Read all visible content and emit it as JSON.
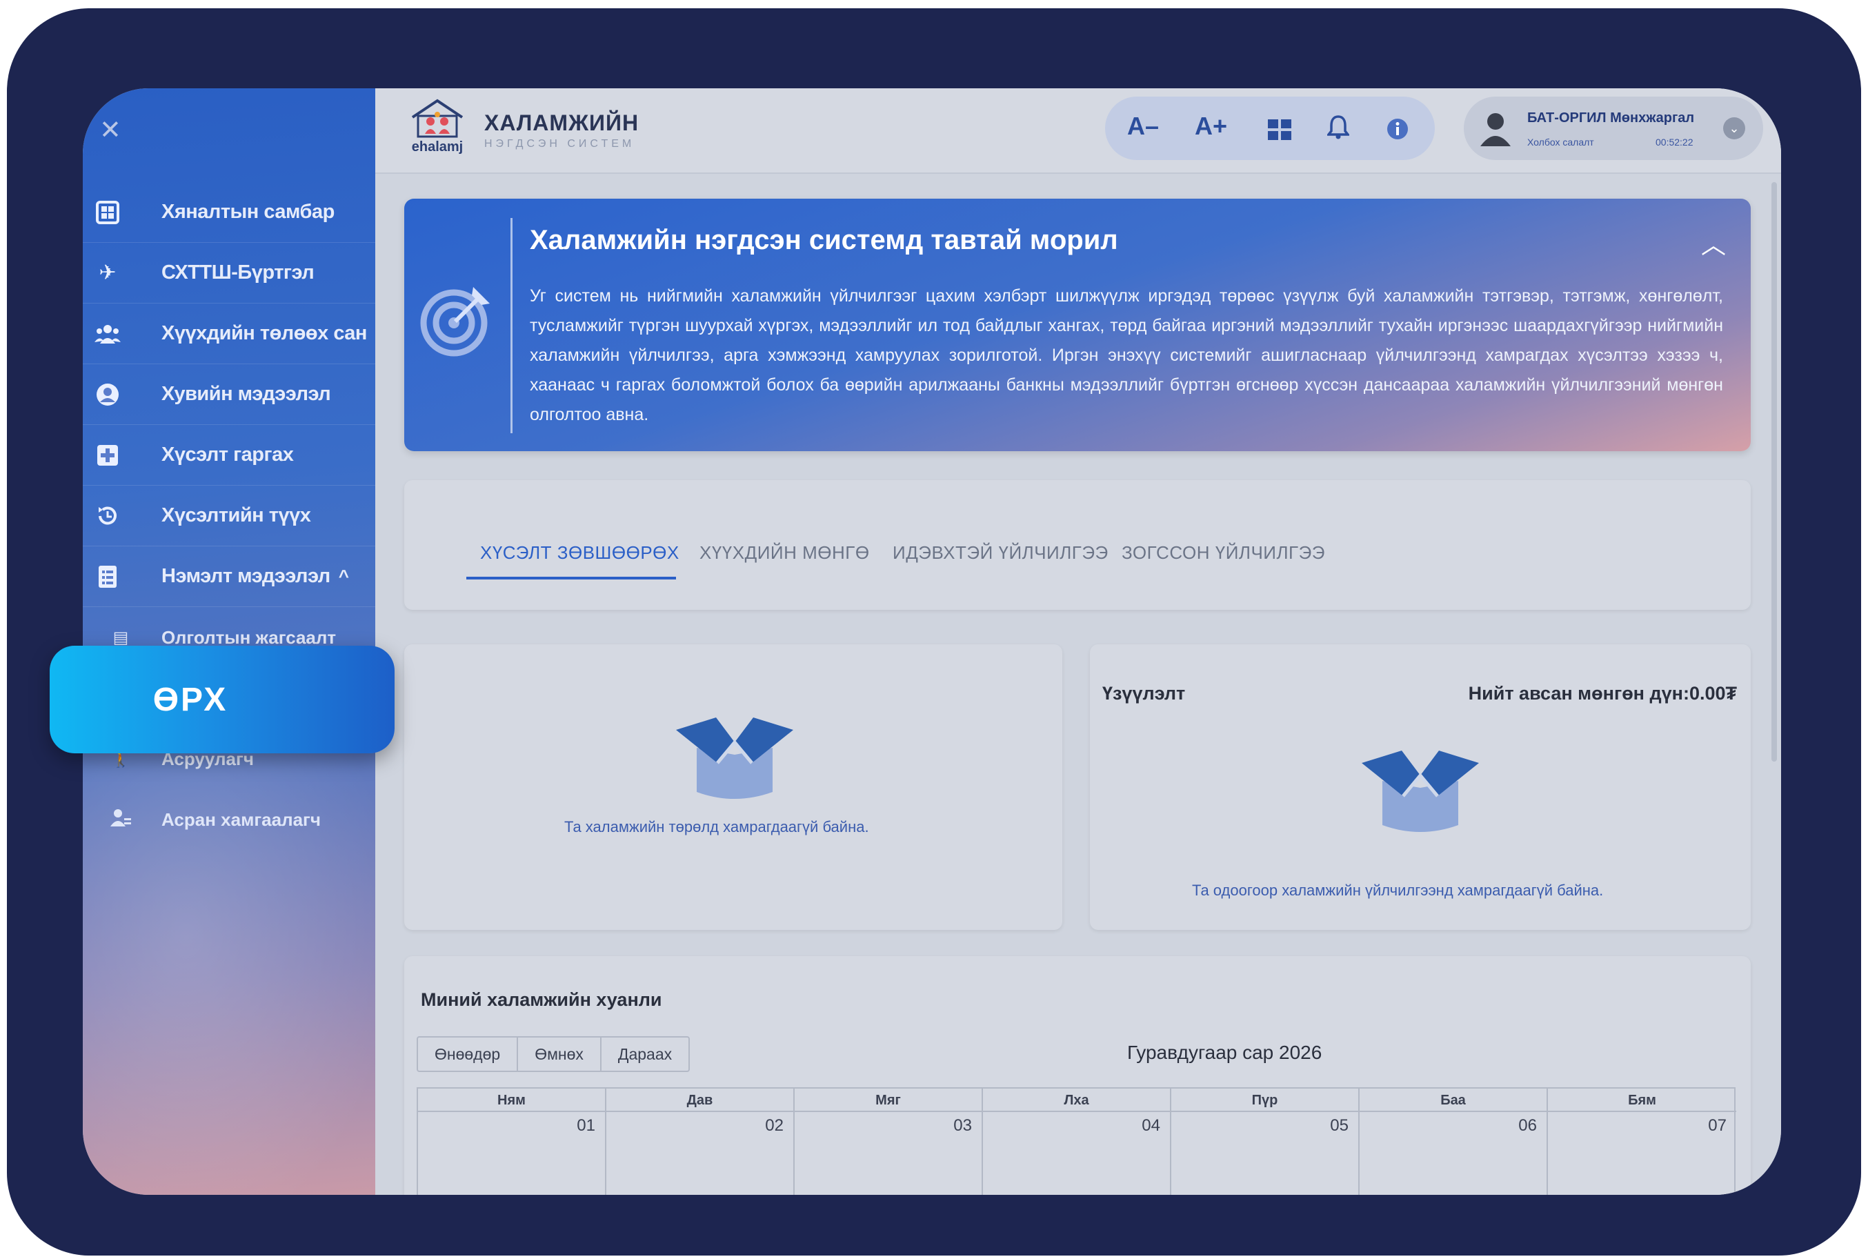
{
  "sidebar": {
    "items": [
      {
        "label": "Хяналтын самбар",
        "icon": "dashboard-grid-icon"
      },
      {
        "label": "СХТТШ-Бүртгэл",
        "icon": "airplane-icon"
      },
      {
        "label": "Хүүхдийн төлөөх сан",
        "icon": "users-group-icon"
      },
      {
        "label": "Хувийн мэдээлэл",
        "icon": "user-circle-icon"
      },
      {
        "label": "Хүсэлт гаргах",
        "icon": "plus-square-icon"
      },
      {
        "label": "Хүсэлтийн түүх",
        "icon": "history-icon"
      },
      {
        "label": "Нэмэлт мэдээлэл",
        "icon": "document-list-icon",
        "chevron": "^"
      }
    ],
    "sub_items": [
      {
        "label": "Олголтын жагсаалт",
        "icon": "list-icon"
      },
      {
        "label": "Асруулагч",
        "icon": "person-walking-icon"
      },
      {
        "label": "Асран хамгаалагч",
        "icon": "guardian-icon"
      }
    ]
  },
  "callout": {
    "label": "ӨРХ"
  },
  "header": {
    "logo_word": "ehalamj",
    "brand_title": "ХАЛАМЖИЙН",
    "brand_subtitle": "НЭГДСЭН СИСТЕМ",
    "tools": {
      "font_decrease": "A–",
      "font_increase": "A+"
    },
    "user": {
      "name": "БАТ-ОРГИЛ Мөнхжаргал",
      "status": "Холбох салалт",
      "time": "00:52:22"
    }
  },
  "banner": {
    "title": "Халамжийн нэгдсэн системд тавтай морил",
    "text": "Уг систем нь нийгмийн халамжийн үйлчилгээг цахим хэлбэрт шилжүүлж иргэдэд төрөөс үзүүлж буй халамжийн тэтгэвэр, тэтгэмж, хөнгөлөлт, тусламжийг түргэн шуурхай хүргэх, мэдээллийг ил тод байдлыг хангах, төрд байгаа иргэний мэдээллийг тухайн иргэнээс шаардахгүйгээр нийгмийн халамжийн үйлчилгээ, арга хэмжээнд хамруулах зорилготой. Иргэн энэхүү системийг ашигласнаар үйлчилгээнд хамрагдах хүсэлтээ хэзээ ч, хаанаас ч гаргах боломжтой болох ба өөрийн арилжааны банкны мэдээллийг бүртгэн өгснөөр хүссэн дансаараа халамжийн үйлчилгээний мөнгөн олголтоо авна."
  },
  "tabs": [
    {
      "label": "ХҮСЭЛТ ЗӨВШӨӨРӨХ",
      "active": true
    },
    {
      "label": "ХҮҮХДИЙН МӨНГӨ"
    },
    {
      "label": "ИДЭВХТЭЙ ҮЙЛЧИЛГЭЭ"
    },
    {
      "label": "ЗОГССОН ҮЙЛЧИЛГЭЭ"
    }
  ],
  "card_left": {
    "empty_text": "Та халамжийн төрөлд хамрагдаагүй байна."
  },
  "card_right": {
    "title": "Үзүүлэлт",
    "total": "Нийт авсан мөнгөн дүн:0.00₮",
    "empty_text": "Та одоогоор халамжийн үйлчилгээнд хамрагдаагүй байна."
  },
  "calendar": {
    "title": "Миний халамжийн хуанли",
    "buttons": [
      "Өнөөдөр",
      "Өмнөх",
      "Дараах"
    ],
    "month": "Гуравдугаар сар 2026",
    "days": [
      {
        "name": "Ням",
        "date": "01"
      },
      {
        "name": "Дав",
        "date": "02"
      },
      {
        "name": "Мяг",
        "date": "03"
      },
      {
        "name": "Лха",
        "date": "04"
      },
      {
        "name": "Пүр",
        "date": "05"
      },
      {
        "name": "Баа",
        "date": "06"
      },
      {
        "name": "Бям",
        "date": "07"
      }
    ]
  },
  "colors": {
    "frame": "#1d2550",
    "accent": "#2b5fc7",
    "callout": "#1a8fe4"
  }
}
